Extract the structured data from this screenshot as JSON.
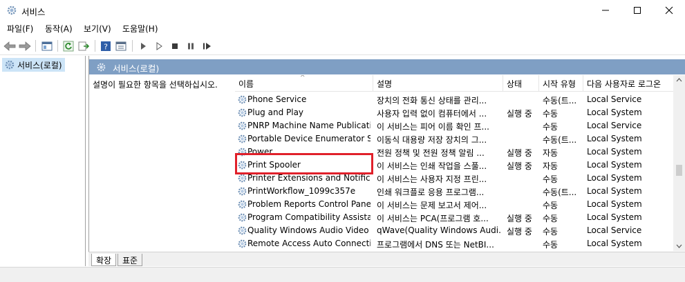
{
  "window": {
    "title": "서비스",
    "buttons": {
      "minimize": "minimize",
      "maximize": "maximize",
      "close": "close"
    }
  },
  "menu": [
    {
      "label": "파일(F)"
    },
    {
      "label": "동작(A)"
    },
    {
      "label": "보기(V)"
    },
    {
      "label": "도움말(H)"
    }
  ],
  "toolbar": {
    "icons": [
      "back-arrow-icon",
      "forward-arrow-icon",
      "console-tree-icon",
      "refresh-icon",
      "export-list-icon",
      "help-icon",
      "properties-icon",
      "play-icon",
      "play-outline-icon",
      "stop-icon",
      "pause-icon",
      "restart-icon"
    ]
  },
  "tree": {
    "item": "서비스(로컬)"
  },
  "main": {
    "header": "서비스(로컬)",
    "description": "설명이 필요한 항목을 선택하십시오."
  },
  "table": {
    "columns": [
      "이름",
      "설명",
      "상태",
      "시작 유형",
      "다음 사용자로 로그온"
    ],
    "rows": [
      {
        "name": "Phone Service",
        "desc": "장치의 전화 통신 상태를 관리...",
        "status": "",
        "startup": "수동(트...",
        "logon": "Local Service"
      },
      {
        "name": "Plug and Play",
        "desc": "사용자 입력 없이 컴퓨터에서 ...",
        "status": "실행 중",
        "startup": "수동",
        "logon": "Local System"
      },
      {
        "name": "PNRP Machine Name Publicati...",
        "desc": "이 서비스는 피어 이름 확인 프...",
        "status": "",
        "startup": "수동",
        "logon": "Local Service"
      },
      {
        "name": "Portable Device Enumerator Se...",
        "desc": "이동식 대용량 저장 장치의 그...",
        "status": "",
        "startup": "수동(트...",
        "logon": "Local System"
      },
      {
        "name": "Power",
        "desc": "전원 정책 및 전원 정책 알림 ...",
        "status": "실행 중",
        "startup": "자동",
        "logon": "Local System"
      },
      {
        "name": "Print Spooler",
        "desc": "이 서비스는 인쇄 작업을 스풀...",
        "status": "실행 중",
        "startup": "자동",
        "logon": "Local System"
      },
      {
        "name": "Printer Extensions and Notifica...",
        "desc": "이 서비스는 사용자 지정 프린...",
        "status": "",
        "startup": "수동",
        "logon": "Local System"
      },
      {
        "name": "PrintWorkflow_1099c357e",
        "desc": "인쇄 워크플로 응용 프로그램...",
        "status": "",
        "startup": "수동(트...",
        "logon": "Local System"
      },
      {
        "name": "Problem Reports Control Panel...",
        "desc": "이 서비스는 문제 보고서 제어...",
        "status": "",
        "startup": "수동",
        "logon": "Local System"
      },
      {
        "name": "Program Compatibility Assista...",
        "desc": "이 서비스는 PCA(프로그램 호...",
        "status": "실행 중",
        "startup": "수동",
        "logon": "Local System"
      },
      {
        "name": "Quality Windows Audio Video ...",
        "desc": "qWave(Quality Windows Audi...",
        "status": "실행 중",
        "startup": "수동",
        "logon": "Local Service"
      },
      {
        "name": "Remote Access Auto Connecti...",
        "desc": "프로그램에서 DNS 또는 NetBI...",
        "status": "",
        "startup": "수동",
        "logon": "Local System"
      }
    ]
  },
  "tabs": [
    {
      "label": "확장"
    },
    {
      "label": "표준"
    }
  ],
  "colors": {
    "header": "#7f9fc4",
    "highlight": "#e0202a",
    "selected": "#cce4f7"
  }
}
